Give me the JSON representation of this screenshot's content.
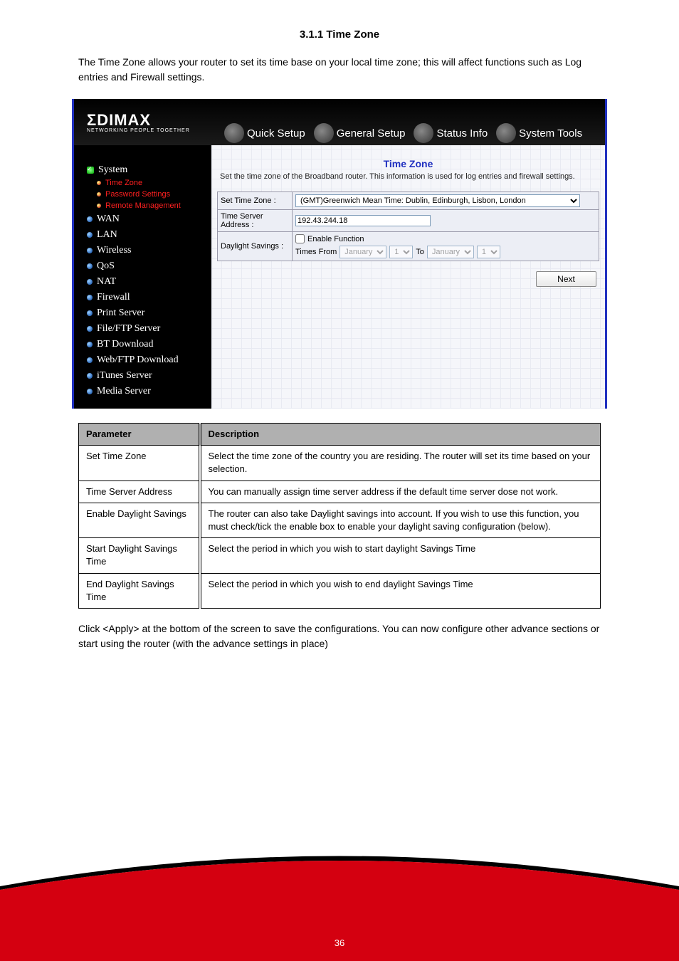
{
  "page": {
    "heading": "3.1.1 Time Zone",
    "description": "The Time Zone allows your router to set its time base on your local time zone; this will affect functions such as Log entries and Firewall settings."
  },
  "router_ui": {
    "logo": {
      "text": "ΣDIMAX",
      "sub": "NETWORKING PEOPLE TOGETHER"
    },
    "tabs": [
      "Quick Setup",
      "General Setup",
      "Status Info",
      "System Tools"
    ],
    "sidebar": {
      "system": "System",
      "system_subs": [
        "Time Zone",
        "Password Settings",
        "Remote Management"
      ],
      "items": [
        "WAN",
        "LAN",
        "Wireless",
        "QoS",
        "NAT",
        "Firewall",
        "Print Server",
        "File/FTP Server",
        "BT Download",
        "Web/FTP Download",
        "iTunes Server",
        "Media Server"
      ]
    },
    "panel": {
      "title": "Time Zone",
      "desc": "Set the time zone of the Broadband router. This information is used for log entries and firewall settings.",
      "rows": {
        "set_time_zone_label": "Set Time Zone :",
        "set_time_zone_value": "(GMT)Greenwich Mean Time: Dublin, Edinburgh, Lisbon, London",
        "time_server_label": "Time Server Address :",
        "time_server_value": "192.43.244.18",
        "daylight_label": "Daylight Savings :",
        "daylight_enable": "Enable Function",
        "times_from": "Times From",
        "to": "To",
        "month": "January",
        "day": "1"
      },
      "next_button": "Next"
    }
  },
  "param_table": {
    "head_param": "Parameter",
    "head_desc": "Description",
    "rows": [
      {
        "param": "Set Time Zone",
        "desc": "Select the time zone of the country you are residing. The router will set its time based on your selection."
      },
      {
        "param": "Time Server Address",
        "desc": "You can manually assign time server address if the default time server dose not work."
      },
      {
        "param": "Enable Daylight Savings",
        "desc": "The router can also take Daylight savings into account. If you wish to use this function, you must check/tick the enable box to enable your daylight saving configuration (below)."
      },
      {
        "param": "Start Daylight Savings Time",
        "desc": "Select the period in which you wish to start daylight Savings Time"
      },
      {
        "param": "End Daylight Savings Time",
        "desc": "Select the period in which you wish to end daylight Savings Time"
      }
    ]
  },
  "after_text": "Click <Apply> at the bottom of the screen to save the configurations. You can now configure other advance sections or start using the router (with the advance settings in place)",
  "page_number": "36"
}
